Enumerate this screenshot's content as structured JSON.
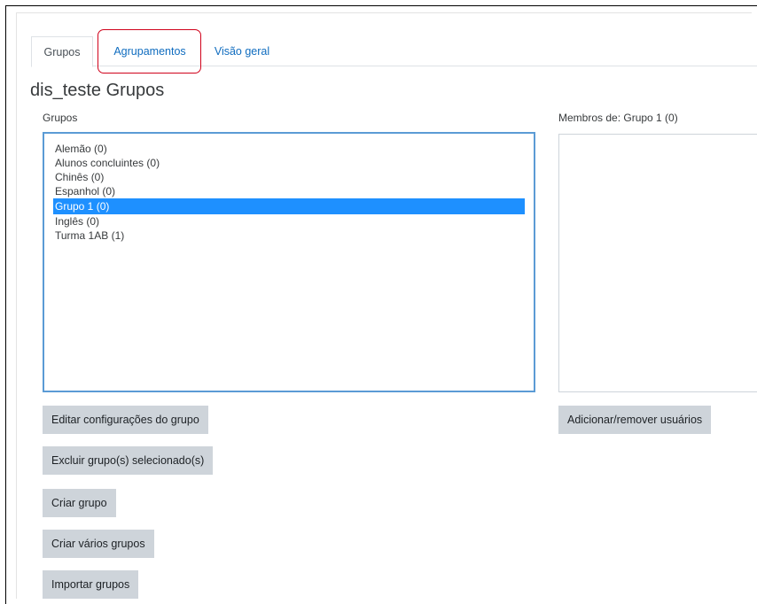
{
  "tabs": [
    {
      "label": "Grupos",
      "active": true
    },
    {
      "label": "Agrupamentos",
      "active": false
    },
    {
      "label": "Visão geral",
      "active": false
    }
  ],
  "page_title": "dis_teste Grupos",
  "groups_panel": {
    "label": "Grupos",
    "options": [
      {
        "label": "Alemão (0)",
        "selected": false
      },
      {
        "label": "Alunos concluintes (0)",
        "selected": false
      },
      {
        "label": "Chinês (0)",
        "selected": false
      },
      {
        "label": "Espanhol (0)",
        "selected": false
      },
      {
        "label": "Grupo 1 (0)",
        "selected": true
      },
      {
        "label": "Inglês (0)",
        "selected": false
      },
      {
        "label": "Turma 1AB (1)",
        "selected": false
      }
    ]
  },
  "members_panel": {
    "label": "Membros de: Grupo 1 (0)"
  },
  "buttons": {
    "edit_group": "Editar configurações do grupo",
    "delete_groups": "Excluir grupo(s) selecionado(s)",
    "create_group": "Criar grupo",
    "create_many": "Criar vários grupos",
    "import_groups": "Importar grupos",
    "add_remove_users": "Adicionar/remover usuários"
  },
  "colors": {
    "selection": "#1e90ff",
    "highlight_outline": "#d0021b",
    "link": "#0f6cbf",
    "button_bg": "#ced4da"
  }
}
